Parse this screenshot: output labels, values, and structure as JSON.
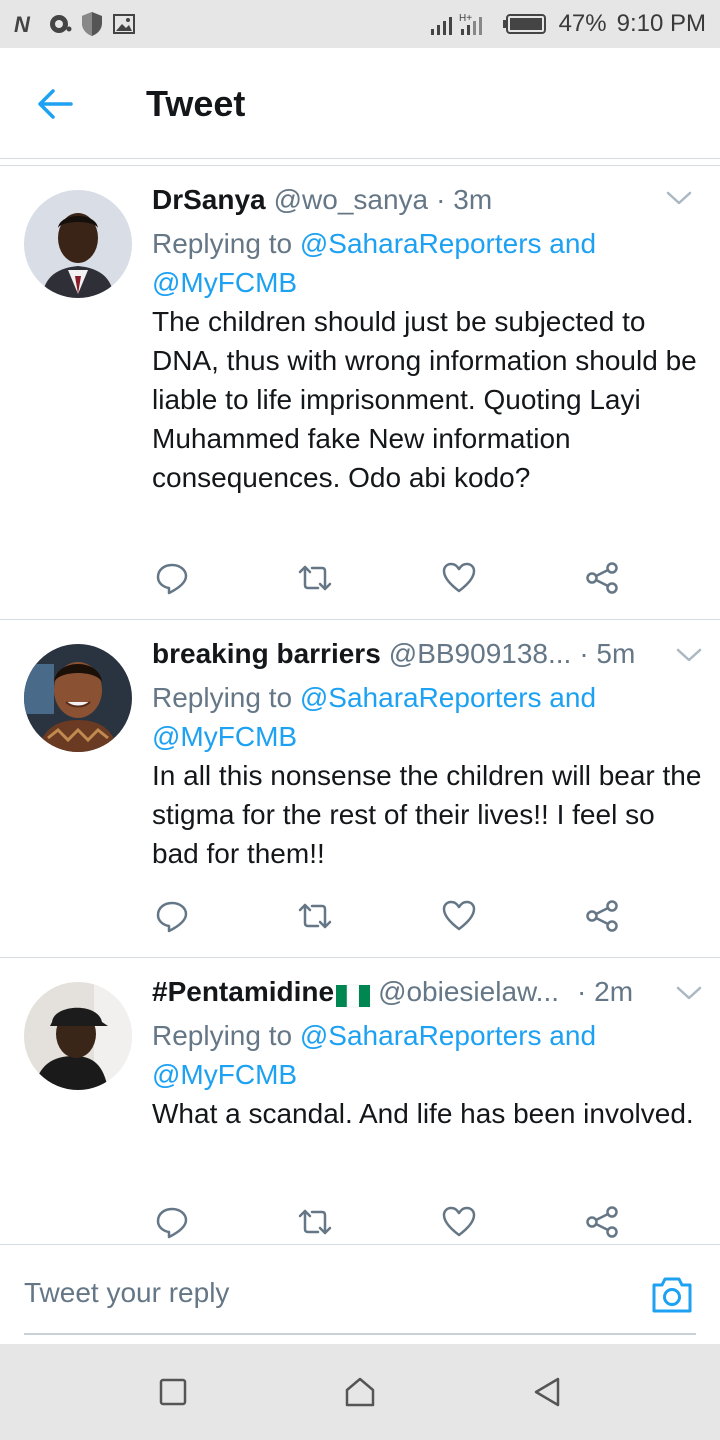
{
  "status_bar": {
    "battery": "47%",
    "time": "9:10 PM",
    "network": "H+"
  },
  "header": {
    "title": "Tweet"
  },
  "tweets": [
    {
      "name": "DrSanya",
      "handle": "@wo_sanya",
      "time": "· 3m",
      "replying_prefix": "Replying to ",
      "mention_1": "@SaharaReporters",
      "and_word": " and",
      "mention_2": "@MyFCMB",
      "text": "The children should just be subjected to DNA, thus with wrong information should be liable to life imprisonment. Quoting Layi Muhammed fake New information consequences. Odo abi kodo?"
    },
    {
      "name": "breaking barriers",
      "handle": "@BB909138...",
      "time": "· 5m",
      "replying_prefix": "Replying to ",
      "mention_1": "@SaharaReporters",
      "and_word": " and",
      "mention_2": "@MyFCMB",
      "text": "In all this nonsense the children will bear the stigma for the rest of their lives!! I feel so bad for them!!"
    },
    {
      "name": "#Pentamidine",
      "handle": "@obiesielaw...",
      "time": "· 2m",
      "replying_prefix": "Replying to ",
      "mention_1": "@SaharaReporters",
      "and_word": " and",
      "mention_2": "@MyFCMB",
      "text": "What a scandal. And life has been involved."
    }
  ],
  "reply_bar": {
    "placeholder": "Tweet your reply"
  },
  "colors": {
    "accent": "#1da1f2",
    "secondary_text": "#657786",
    "primary_text": "#14171a",
    "divider": "#d6dbe0"
  }
}
